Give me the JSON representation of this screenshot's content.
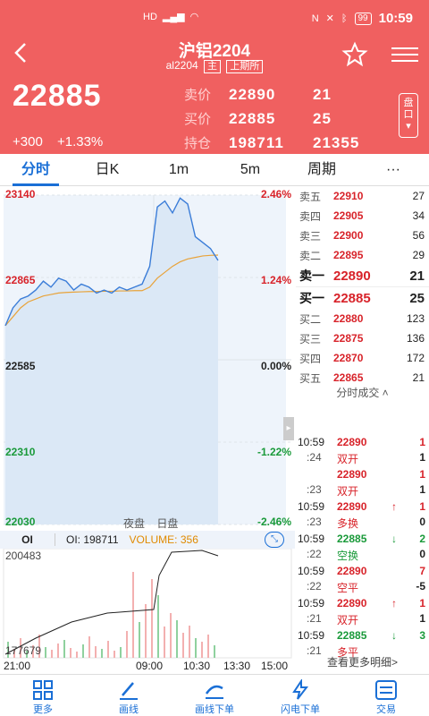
{
  "statusbar": {
    "time": "10:59",
    "battery": "99",
    "left_icons": [
      "HD",
      "4G",
      "wifi"
    ],
    "right_icons": [
      "nfc",
      "mute",
      "bluetooth"
    ]
  },
  "header": {
    "title": "沪铝2204",
    "code": "al2204",
    "tag_main": "主",
    "tag_exchange": "上期所",
    "last_price": "22885",
    "change": "+300",
    "change_pct": "+1.33%",
    "quotes": [
      {
        "label": "卖价",
        "v1": "22890",
        "v2": "21"
      },
      {
        "label": "买价",
        "v1": "22885",
        "v2": "25"
      },
      {
        "label": "持仓",
        "v1": "198711",
        "v2": "21355"
      }
    ],
    "pankou": "盘口",
    "accent": "#f06060"
  },
  "tabs": [
    "分时",
    "日K",
    "1m",
    "5m",
    "周期",
    "···"
  ],
  "chart": {
    "y_left": [
      "23140",
      "22865",
      "22585",
      "22310",
      "22030"
    ],
    "y_right": [
      "2.46%",
      "1.24%",
      "0.00%",
      "-1.22%",
      "-2.46%"
    ],
    "sessions": [
      "夜盘",
      "日盘"
    ],
    "oi_button": "OI",
    "oi_text": "OI: 198711",
    "volume_text": "VOLUME: 356",
    "vol_top": "200483",
    "vol_bottom": "177679",
    "time_labels": [
      "21:00",
      "09:00",
      "10:30",
      "13:30",
      "15:00"
    ]
  },
  "chart_data": {
    "type": "line",
    "series": [
      {
        "name": "价格",
        "values": [
          22700,
          22760,
          22790,
          22800,
          22820,
          22850,
          22830,
          22860,
          22850,
          22820,
          22840,
          22830,
          22810,
          22820,
          22810,
          22830,
          22820,
          22830,
          22840,
          22900,
          23100,
          23120,
          23080,
          23130,
          23110,
          23000,
          22980,
          22960,
          22920
        ]
      },
      {
        "name": "均价",
        "values": [
          22700,
          22730,
          22760,
          22780,
          22790,
          22800,
          22805,
          22810,
          22812,
          22813,
          22814,
          22815,
          22815,
          22816,
          22816,
          22817,
          22817,
          22818,
          22818,
          22830,
          22860,
          22880,
          22900,
          22915,
          22925,
          22930,
          22935,
          22937,
          22938
        ]
      }
    ],
    "ylim": [
      22030,
      23140
    ]
  },
  "book": {
    "asks": [
      {
        "label": "卖五",
        "price": "22910",
        "vol": "27"
      },
      {
        "label": "卖四",
        "price": "22905",
        "vol": "34"
      },
      {
        "label": "卖三",
        "price": "22900",
        "vol": "56"
      },
      {
        "label": "卖二",
        "price": "22895",
        "vol": "29"
      },
      {
        "label": "卖一",
        "price": "22890",
        "vol": "21"
      }
    ],
    "bids": [
      {
        "label": "买一",
        "price": "22885",
        "vol": "25"
      },
      {
        "label": "买二",
        "price": "22880",
        "vol": "123"
      },
      {
        "label": "买三",
        "price": "22875",
        "vol": "136"
      },
      {
        "label": "买四",
        "price": "22870",
        "vol": "172"
      },
      {
        "label": "买五",
        "price": "22865",
        "vol": "21"
      }
    ],
    "ticks_title": "分时成交",
    "more": "查看更多明细>"
  },
  "ticks": [
    {
      "t1": "10:59",
      "t2": ":24",
      "price": "22890",
      "pcolor": "red",
      "type": "双开",
      "tcolor": "red",
      "arrow": "",
      "vol": "1",
      "oi": "1"
    },
    {
      "t1": "",
      "t2": ":23",
      "price": "22890",
      "pcolor": "red",
      "type": "双开",
      "tcolor": "red",
      "arrow": "",
      "vol": "1",
      "oi": "1"
    },
    {
      "t1": "10:59",
      "t2": ":23",
      "price": "22890",
      "pcolor": "red",
      "type": "多换",
      "tcolor": "red",
      "arrow": "↑",
      "vol": "1",
      "oi": "0"
    },
    {
      "t1": "10:59",
      "t2": ":22",
      "price": "22885",
      "pcolor": "green",
      "type": "空换",
      "tcolor": "green",
      "arrow": "↓",
      "vol": "2",
      "oi": "0"
    },
    {
      "t1": "10:59",
      "t2": ":22",
      "price": "22890",
      "pcolor": "red",
      "type": "空平",
      "tcolor": "red",
      "arrow": "",
      "vol": "7",
      "oi": "-5"
    },
    {
      "t1": "10:59",
      "t2": ":21",
      "price": "22890",
      "pcolor": "red",
      "type": "双开",
      "tcolor": "red",
      "arrow": "↑",
      "vol": "1",
      "oi": "1"
    },
    {
      "t1": "10:59",
      "t2": ":21",
      "price": "22885",
      "pcolor": "green",
      "type": "多平",
      "tcolor": "red",
      "arrow": "↓",
      "vol": "3",
      "oi": ""
    }
  ],
  "bottombar": [
    {
      "label": "更多",
      "icon": "grid-icon"
    },
    {
      "label": "画线",
      "icon": "pen-icon"
    },
    {
      "label": "画线下单",
      "icon": "draw-order-icon"
    },
    {
      "label": "闪电下单",
      "icon": "lightning-icon"
    },
    {
      "label": "交易",
      "icon": "trade-icon"
    }
  ]
}
